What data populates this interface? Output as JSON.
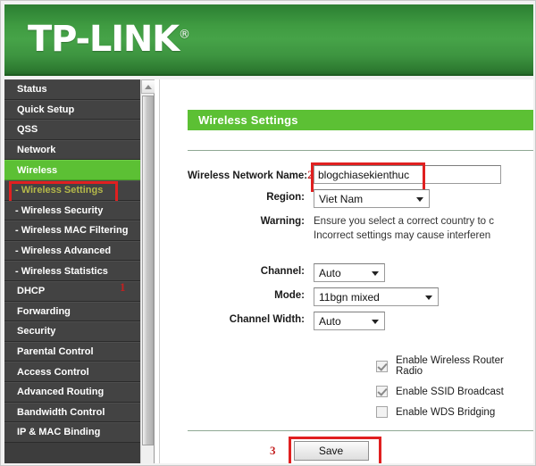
{
  "header": {
    "brand": "TP-LINK",
    "registered_mark": "®"
  },
  "sidebar": {
    "items": [
      {
        "label": "Status",
        "state": "normal"
      },
      {
        "label": "Quick Setup",
        "state": "normal"
      },
      {
        "label": "QSS",
        "state": "normal"
      },
      {
        "label": "Network",
        "state": "normal"
      },
      {
        "label": "Wireless",
        "state": "active"
      },
      {
        "label": "- Wireless Settings",
        "state": "current"
      },
      {
        "label": "- Wireless Security",
        "state": "sub"
      },
      {
        "label": "- Wireless MAC Filtering",
        "state": "sub"
      },
      {
        "label": "- Wireless Advanced",
        "state": "sub"
      },
      {
        "label": "- Wireless Statistics",
        "state": "sub"
      },
      {
        "label": "DHCP",
        "state": "normal"
      },
      {
        "label": "Forwarding",
        "state": "normal"
      },
      {
        "label": "Security",
        "state": "normal"
      },
      {
        "label": "Parental Control",
        "state": "normal"
      },
      {
        "label": "Access Control",
        "state": "normal"
      },
      {
        "label": "Advanced Routing",
        "state": "normal"
      },
      {
        "label": "Bandwidth Control",
        "state": "normal"
      },
      {
        "label": "IP & MAC Binding",
        "state": "normal"
      }
    ]
  },
  "annotations": {
    "step1": "1",
    "step2": "2",
    "step3": "3",
    "box_color": "#e02020",
    "marker_color": "#c42020"
  },
  "main": {
    "section_title": "Wireless Settings",
    "fields": {
      "ssid_label": "Wireless Network Name:",
      "ssid_value": "blogchiasekienthuc",
      "ssid_placeholder": "",
      "region_label": "Region:",
      "region_value": "Viet Nam",
      "warning_label": "Warning:",
      "warning_line1": "Ensure you select a correct country to c",
      "warning_line2": "Incorrect settings may cause interferen",
      "channel_label": "Channel:",
      "channel_value": "Auto",
      "mode_label": "Mode:",
      "mode_value": "11bgn mixed",
      "channel_width_label": "Channel Width:",
      "channel_width_value": "Auto"
    },
    "checkboxes": [
      {
        "label": "Enable Wireless Router Radio",
        "checked": true
      },
      {
        "label": "Enable SSID Broadcast",
        "checked": true
      },
      {
        "label": "Enable WDS Bridging",
        "checked": false
      }
    ],
    "save_label": "Save"
  },
  "theme": {
    "green": "#5cc034",
    "header_green": "#3f9b41",
    "sidebar_dark": "#434343"
  }
}
